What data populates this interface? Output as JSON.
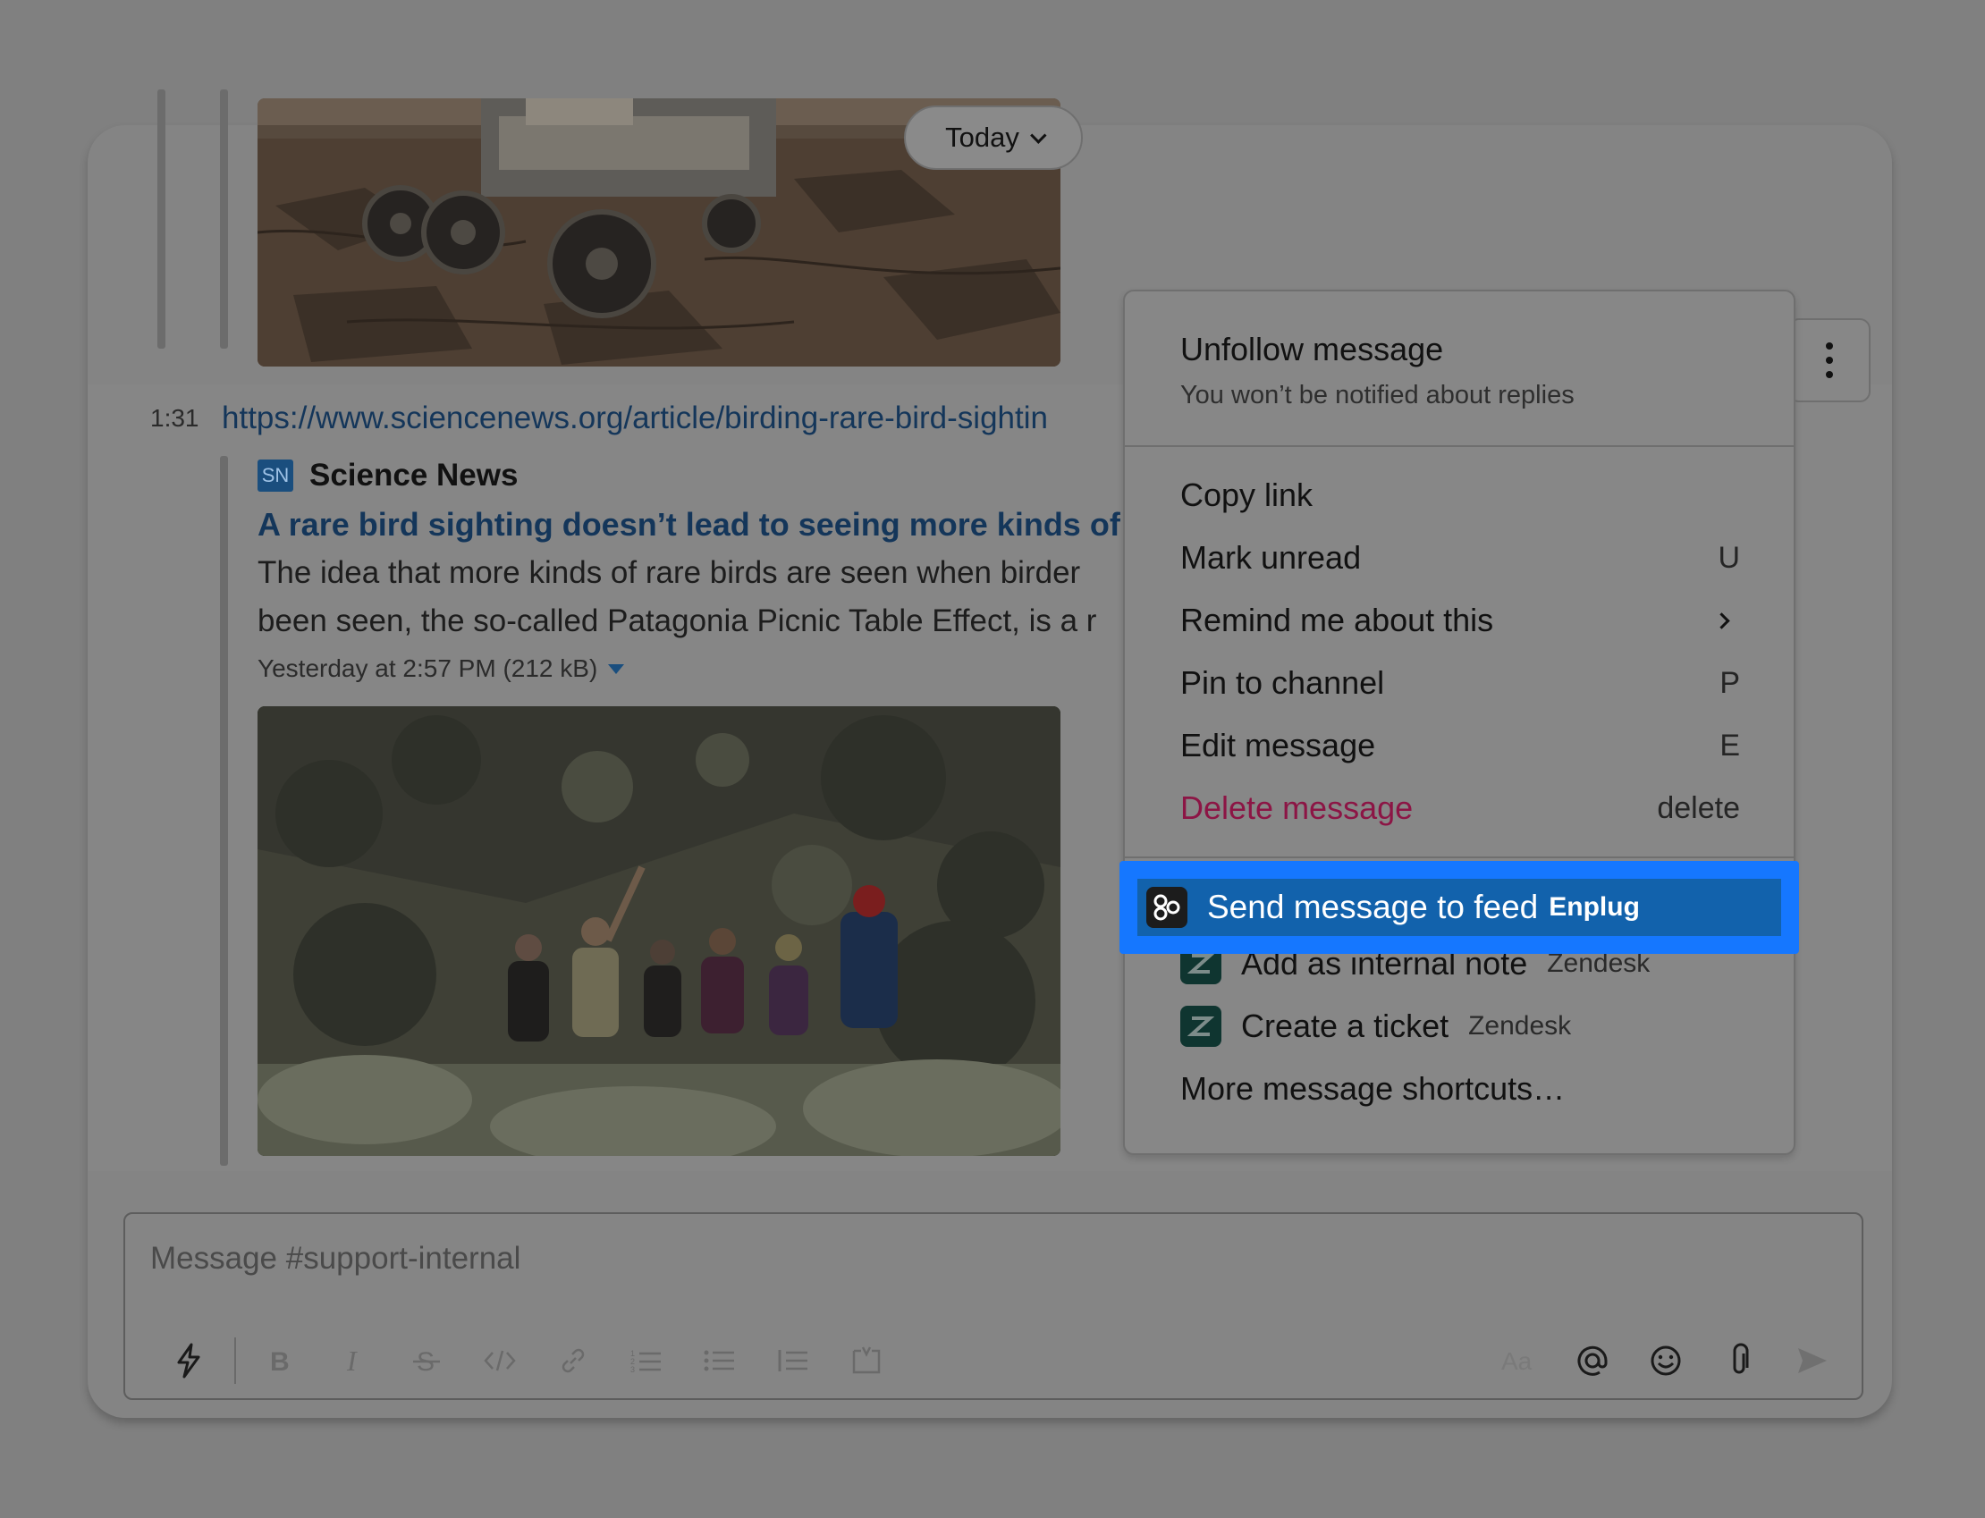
{
  "date_divider": {
    "label": "Today"
  },
  "message": {
    "time": "1:31",
    "link": "https://www.sciencenews.org/article/birding-rare-bird-sightin"
  },
  "unfurl": {
    "source_icon": "SN",
    "source": "Science News",
    "title": "A rare bird sighting doesn’t lead to seeing more kinds of rar",
    "desc_line1": "The idea that more kinds of rare birds are seen when birder",
    "desc_line2": "been seen, the so-called Patagonia Picnic Table Effect, is a r",
    "meta": "Yesterday at 2:57 PM (212 kB)"
  },
  "menu": {
    "header_title": "Unfollow message",
    "header_subtitle": "You won’t be notified about replies",
    "items": [
      {
        "label": "Copy link",
        "key": ""
      },
      {
        "label": "Mark unread",
        "key": "U"
      },
      {
        "label": "Remind me about this",
        "key": ""
      },
      {
        "label": "Pin to channel",
        "key": "P"
      },
      {
        "label": "Edit message",
        "key": "E"
      },
      {
        "label": "Delete message",
        "key": "delete"
      }
    ],
    "highlighted": {
      "label": "Send message to feed",
      "app": "Enplug"
    },
    "apps": [
      {
        "label": "Add as internal note",
        "app": "Zendesk"
      },
      {
        "label": "Create a ticket",
        "app": "Zendesk"
      }
    ],
    "more": "More message shortcuts…"
  },
  "composer": {
    "placeholder": "Message #support-internal"
  },
  "colors": {
    "highlight_border": "#1577ff",
    "highlight_fill": "#1262ac",
    "danger": "#8c1545",
    "link": "#14365a"
  }
}
